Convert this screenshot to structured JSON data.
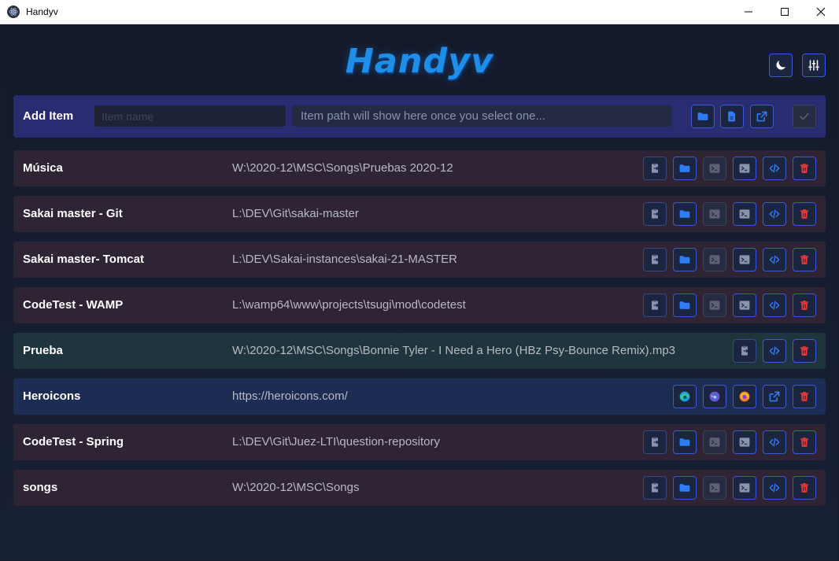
{
  "window": {
    "title": "Handyv",
    "app_icon": "electron-atom-icon",
    "controls": [
      "minimize-icon",
      "maximize-icon",
      "close-icon"
    ]
  },
  "header": {
    "logo_text": "Handyv",
    "theme_icon": "moon-icon",
    "settings_icon": "sliders-icon"
  },
  "add_item": {
    "label": "Add Item",
    "name_placeholder": "Item name",
    "name_value": "",
    "path_text": "Item path will show here once you select one...",
    "buttons": [
      "folder-icon",
      "file-icon",
      "external-link-icon",
      "check-icon"
    ]
  },
  "colors": {
    "accent": "#3b5bd6",
    "directory_row": "#2e2433",
    "file_row": "#1f353d",
    "web_row": "#1d2c52",
    "add_bar": "#2a2c72",
    "delete": "#e5383b"
  },
  "items": [
    {
      "name": "Música",
      "path": "W:\\2020-12\\MSC\\Songs\\Pruebas 2020-12",
      "type": "directory"
    },
    {
      "name": "Sakai master - Git",
      "path": "L:\\DEV\\Git\\sakai-master",
      "type": "directory"
    },
    {
      "name": "Sakai master- Tomcat",
      "path": "L:\\DEV\\Sakai-instances\\sakai-21-MASTER",
      "type": "directory"
    },
    {
      "name": "CodeTest - WAMP",
      "path": "L:\\wamp64\\www\\projects\\tsugi\\mod\\codetest",
      "type": "directory"
    },
    {
      "name": "Prueba",
      "path": "W:\\2020-12\\MSC\\Songs\\Bonnie Tyler - I Need a Hero (HBz Psy-Bounce Remix).mp3",
      "type": "file"
    },
    {
      "name": "Heroicons",
      "path": "https://heroicons.com/",
      "type": "web"
    },
    {
      "name": "CodeTest - Spring",
      "path": "L:\\DEV\\Git\\Juez-LTI\\question-repository",
      "type": "directory"
    },
    {
      "name": "songs",
      "path": "W:\\2020-12\\MSC\\Songs",
      "type": "directory"
    }
  ],
  "row_actions": {
    "directory": [
      "clipboard-copy-icon",
      "folder-icon",
      "terminal-icon",
      "terminal-icon",
      "code-icon",
      "trash-icon"
    ],
    "file": [
      "clipboard-copy-icon",
      "code-icon",
      "trash-icon"
    ],
    "web": [
      "edge-icon",
      "firefox-dev-icon",
      "firefox-icon",
      "external-link-icon",
      "trash-icon"
    ]
  }
}
